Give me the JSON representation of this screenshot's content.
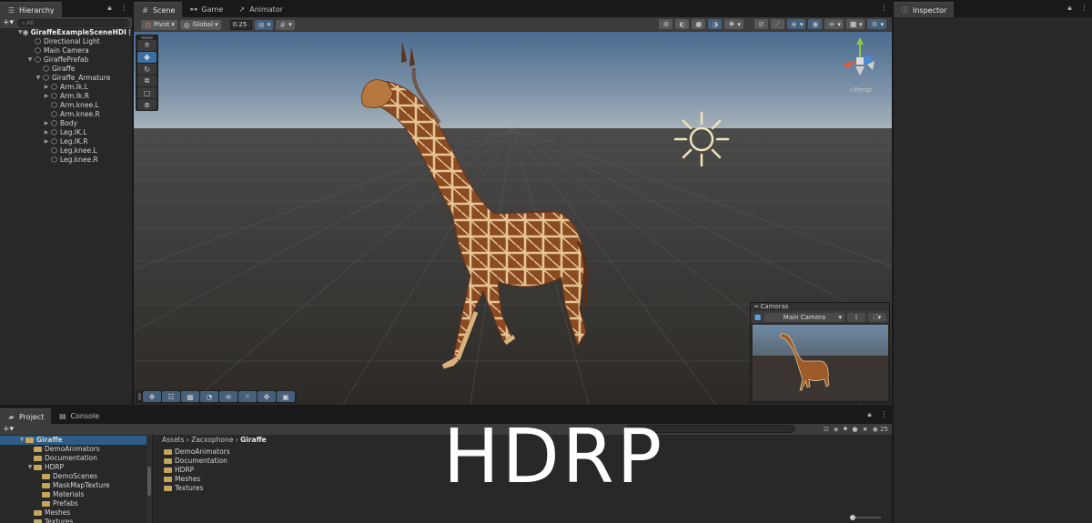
{
  "hierarchy": {
    "tab": "Hierarchy",
    "search_placeholder": "All",
    "add_label": "+▾",
    "items": [
      {
        "label": "GiraffeExampleSceneHDI",
        "depth": 0,
        "arrow": "▼",
        "kind": "scene"
      },
      {
        "label": "Directional Light",
        "depth": 1,
        "arrow": "",
        "kind": "object"
      },
      {
        "label": "Main Camera",
        "depth": 1,
        "arrow": "",
        "kind": "object"
      },
      {
        "label": "GiraffePrefab",
        "depth": 1,
        "arrow": "▼",
        "kind": "object"
      },
      {
        "label": "Giraffe",
        "depth": 2,
        "arrow": "",
        "kind": "object"
      },
      {
        "label": "Giraffe_Armature",
        "depth": 2,
        "arrow": "▼",
        "kind": "object"
      },
      {
        "label": "Arm.Ik.L",
        "depth": 3,
        "arrow": "▶",
        "kind": "object"
      },
      {
        "label": "Arm.Ik.R",
        "depth": 3,
        "arrow": "▶",
        "kind": "object"
      },
      {
        "label": "Arm.knee.L",
        "depth": 3,
        "arrow": "",
        "kind": "object"
      },
      {
        "label": "Arm.knee.R",
        "depth": 3,
        "arrow": "",
        "kind": "object"
      },
      {
        "label": "Body",
        "depth": 3,
        "arrow": "▶",
        "kind": "object"
      },
      {
        "label": "Leg.IK.L",
        "depth": 3,
        "arrow": "▶",
        "kind": "object"
      },
      {
        "label": "Leg.IK.R",
        "depth": 3,
        "arrow": "▶",
        "kind": "object"
      },
      {
        "label": "Leg.knee.L",
        "depth": 3,
        "arrow": "",
        "kind": "object"
      },
      {
        "label": "Leg.knee.R",
        "depth": 3,
        "arrow": "",
        "kind": "object"
      }
    ]
  },
  "scene": {
    "tabs": [
      {
        "label": "Scene",
        "icon": "#",
        "active": true
      },
      {
        "label": "Game",
        "icon": "👓",
        "active": false
      },
      {
        "label": "Animator",
        "icon": "↗",
        "active": false
      }
    ],
    "pivot_label": "Pivot",
    "global_label": "Global",
    "snap_value": "0.25",
    "persp_label": "≺Persp"
  },
  "cameras": {
    "title": "Cameras",
    "selected": "Main Camera",
    "info_icon": "i"
  },
  "inspector": {
    "tab": "Inspector"
  },
  "project": {
    "tabs": [
      {
        "label": "Project",
        "active": true
      },
      {
        "label": "Console",
        "active": false
      }
    ],
    "tree": [
      {
        "label": "Giraffe",
        "depth": 0,
        "arrow": "▼",
        "selected": true
      },
      {
        "label": "DemoAnimators",
        "depth": 1,
        "arrow": "",
        "selected": false
      },
      {
        "label": "Documentation",
        "depth": 1,
        "arrow": "",
        "selected": false
      },
      {
        "label": "HDRP",
        "depth": 1,
        "arrow": "▼",
        "selected": false
      },
      {
        "label": "DemoScenes",
        "depth": 2,
        "arrow": "",
        "selected": false
      },
      {
        "label": "MaskMapTexture",
        "depth": 2,
        "arrow": "",
        "selected": false
      },
      {
        "label": "Materials",
        "depth": 2,
        "arrow": "",
        "selected": false
      },
      {
        "label": "Prefabs",
        "depth": 2,
        "arrow": "",
        "selected": false
      },
      {
        "label": "Meshes",
        "depth": 1,
        "arrow": "",
        "selected": false
      },
      {
        "label": "Textures",
        "depth": 1,
        "arrow": "",
        "selected": false
      }
    ],
    "breadcrumb": [
      "Assets",
      "Zacxophone",
      "Giraffe"
    ],
    "contents": [
      "DemoAnimators",
      "Documentation",
      "HDRP",
      "Meshes",
      "Textures"
    ],
    "hidden_count": "25"
  },
  "overlay_text": "HDRP",
  "colors": {
    "panel": "#282828",
    "toolbar": "#3c3c3c",
    "selection": "#2c5d87",
    "accent_blue": "#46607c",
    "folder": "#c5a45c"
  }
}
